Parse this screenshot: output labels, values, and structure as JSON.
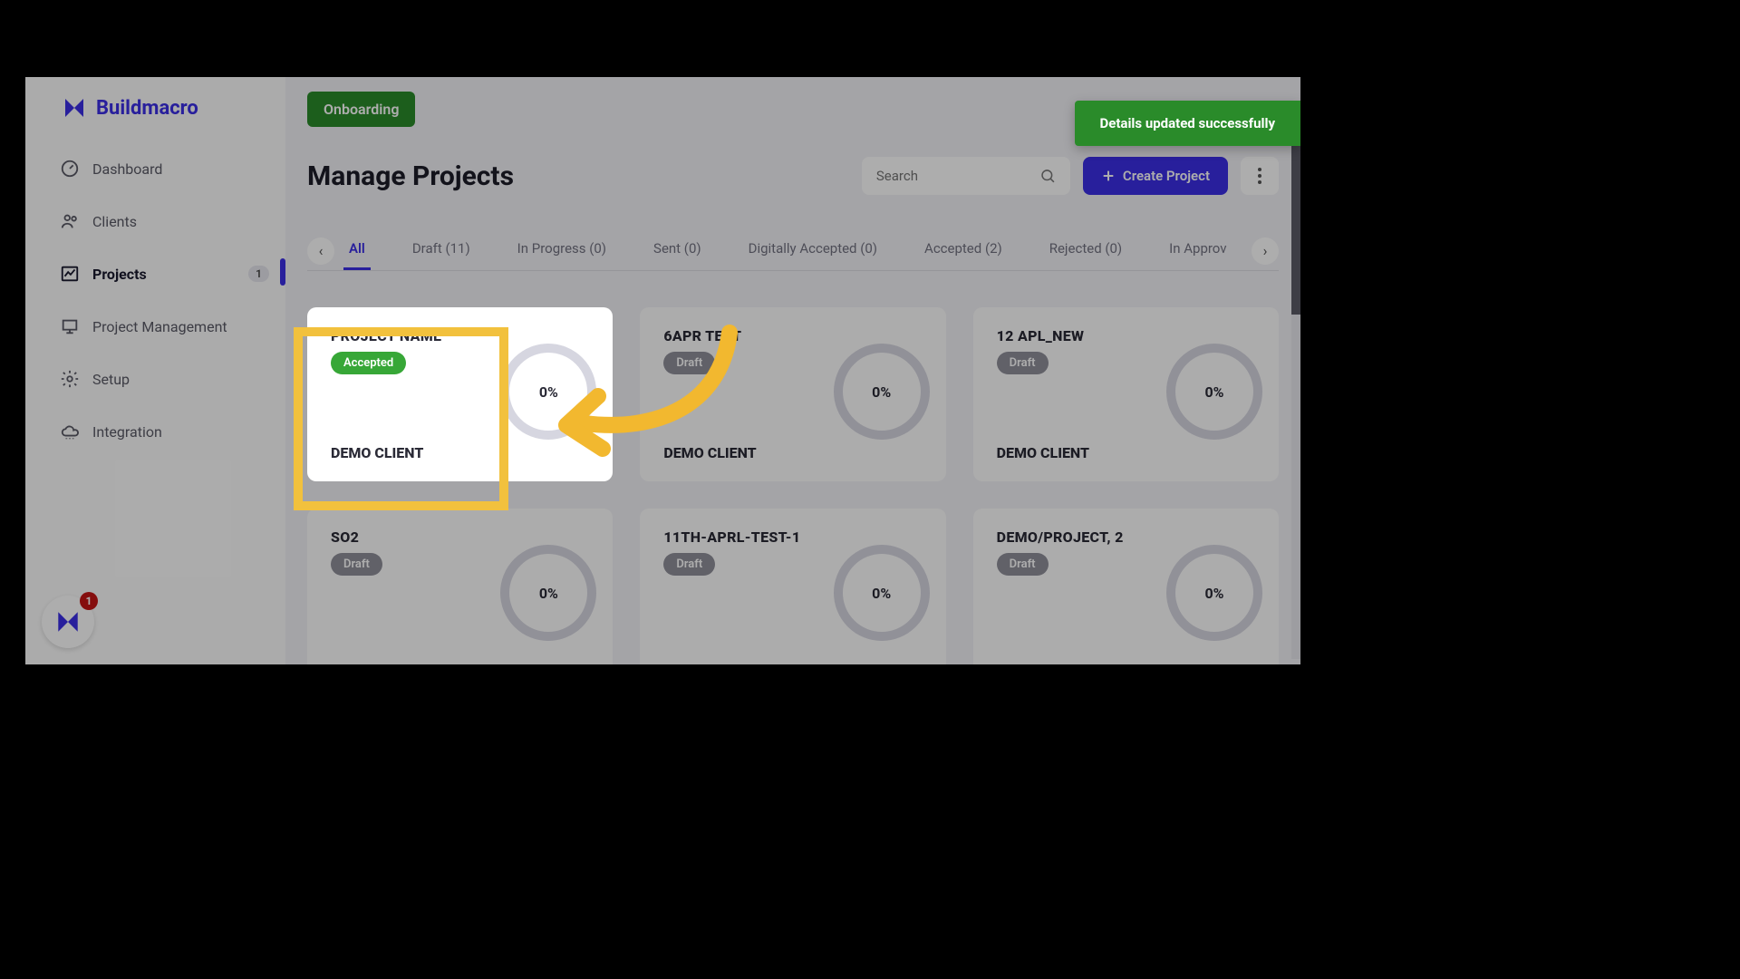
{
  "brand": {
    "name": "Buildmacro"
  },
  "toast": {
    "message": "Details updated successfully"
  },
  "sidebar": {
    "items": [
      {
        "label": "Dashboard"
      },
      {
        "label": "Clients"
      },
      {
        "label": "Projects",
        "badge": "1"
      },
      {
        "label": "Project Management"
      },
      {
        "label": "Setup"
      },
      {
        "label": "Integration"
      }
    ],
    "fab_count": "1"
  },
  "topbar": {
    "onboarding_label": "Onboarding"
  },
  "header": {
    "title": "Manage Projects",
    "search_placeholder": "Search",
    "create_label": "Create Project"
  },
  "tabs": [
    {
      "label": "All",
      "active": true
    },
    {
      "label": "Draft (11)"
    },
    {
      "label": "In Progress (0)"
    },
    {
      "label": "Sent (0)"
    },
    {
      "label": "Digitally Accepted (0)"
    },
    {
      "label": "Accepted (2)"
    },
    {
      "label": "Rejected (0)"
    },
    {
      "label": "In Approv"
    }
  ],
  "projects": [
    {
      "name": "PROJECT NAME",
      "status": "Accepted",
      "status_class": "accepted",
      "client": "DEMO CLIENT",
      "progress": "0%",
      "highlighted": true
    },
    {
      "name": "6APR TEST",
      "status": "Draft",
      "status_class": "draft",
      "client": "DEMO CLIENT",
      "progress": "0%"
    },
    {
      "name": "12 APL_NEW",
      "status": "Draft",
      "status_class": "draft",
      "client": "DEMO CLIENT",
      "progress": "0%"
    },
    {
      "name": "SO2",
      "status": "Draft",
      "status_class": "draft",
      "client": "",
      "progress": "0%"
    },
    {
      "name": "11TH-APRL-TEST-1",
      "status": "Draft",
      "status_class": "draft",
      "client": "",
      "progress": "0%"
    },
    {
      "name": "DEMO/PROJECT, 2",
      "status": "Draft",
      "status_class": "draft",
      "client": "",
      "progress": "0%"
    }
  ],
  "colors": {
    "accent": "#3b2fe6",
    "success": "#2a8b2a",
    "highlight": "#f2c13d"
  }
}
